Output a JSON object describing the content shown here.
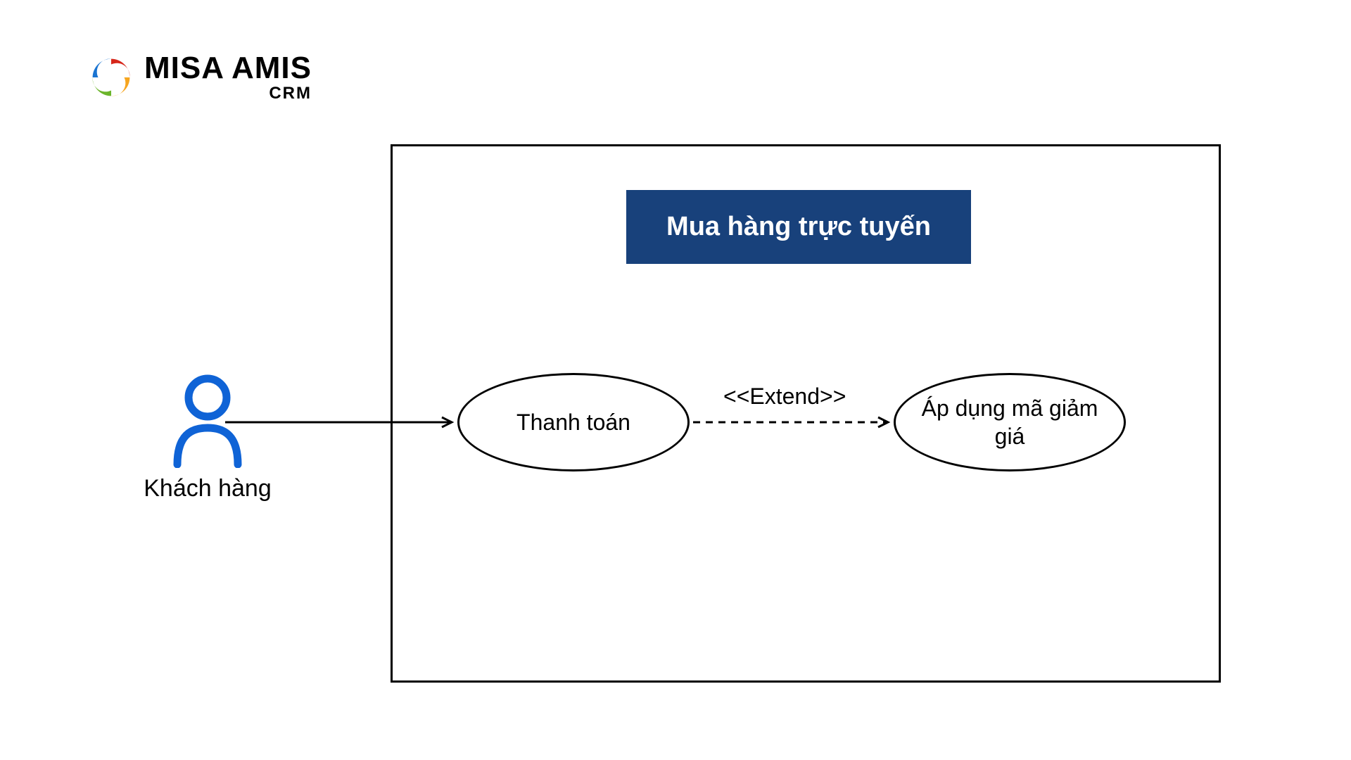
{
  "logo": {
    "text_main": "MISA AMIS",
    "text_sub": "CRM",
    "colors": {
      "red": "#d6261a",
      "orange": "#f6a51f",
      "green": "#6cb52b",
      "blue": "#1a74d1"
    }
  },
  "actor": {
    "label": "Khách hàng",
    "color": "#0f63d6"
  },
  "system": {
    "title": "Mua hàng trực tuyến",
    "title_bg": "#18417b"
  },
  "usecases": {
    "uc1": "Thanh toán",
    "uc2": "Áp dụng mã giảm giá"
  },
  "relations": {
    "extend_label": "<<Extend>>"
  }
}
